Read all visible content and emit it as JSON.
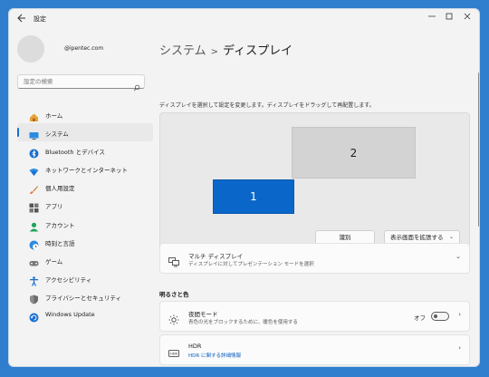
{
  "titlebar": {
    "title": "設定",
    "back_icon": "back-arrow-icon",
    "minimize_icon": "minimize-icon",
    "maximize_icon": "maximize-icon",
    "close_icon": "close-icon"
  },
  "account": {
    "email": "@ipentec.com"
  },
  "search": {
    "placeholder": "設定の検索",
    "icon": "search-icon"
  },
  "sidebar": {
    "accent": "#1a6ed1",
    "items": [
      {
        "label": "ホーム",
        "icon": "home-icon",
        "active": false
      },
      {
        "label": "システム",
        "icon": "system-icon",
        "active": true
      },
      {
        "label": "Bluetooth とデバイス",
        "icon": "bluetooth-icon",
        "active": false
      },
      {
        "label": "ネットワークとインターネット",
        "icon": "network-icon",
        "active": false
      },
      {
        "label": "個人用設定",
        "icon": "brush-icon",
        "active": false
      },
      {
        "label": "アプリ",
        "icon": "apps-icon",
        "active": false
      },
      {
        "label": "アカウント",
        "icon": "account-icon",
        "active": false
      },
      {
        "label": "時刻と言語",
        "icon": "time-language-icon",
        "active": false
      },
      {
        "label": "ゲーム",
        "icon": "gaming-icon",
        "active": false
      },
      {
        "label": "アクセシビリティ",
        "icon": "accessibility-icon",
        "active": false
      },
      {
        "label": "プライバシーとセキュリティ",
        "icon": "shield-icon",
        "active": false
      },
      {
        "label": "Windows Update",
        "icon": "windows-update-icon",
        "active": false
      }
    ]
  },
  "breadcrumb": {
    "parent": "システム",
    "separator": ">",
    "current": "ディスプレイ"
  },
  "display": {
    "instruction": "ディスプレイを選択して設定を変更します。ディスプレイをドラッグして再配置します。",
    "monitor_1_label": "1",
    "monitor_2_label": "2",
    "identify_label": "識別",
    "extend_label": "表示画面を拡張する",
    "selected_color": "#0a67c9"
  },
  "multi_display": {
    "title": "マルチ ディスプレイ",
    "description": "ディスプレイに対してプレゼンテーション モードを選択",
    "icon": "multi-display-icon",
    "chevron": "⌄"
  },
  "brightness_section": {
    "header": "明るさと色"
  },
  "night_light": {
    "title": "夜間モード",
    "description": "青色の光をブロックするために、暖色を使用する",
    "icon": "sun-icon",
    "toggle_label": "オフ",
    "toggle_on": false,
    "chevron": "›"
  },
  "hdr": {
    "title": "HDR",
    "link": "HDR に関する詳細情報",
    "icon": "hdr-icon",
    "chevron": "›"
  }
}
